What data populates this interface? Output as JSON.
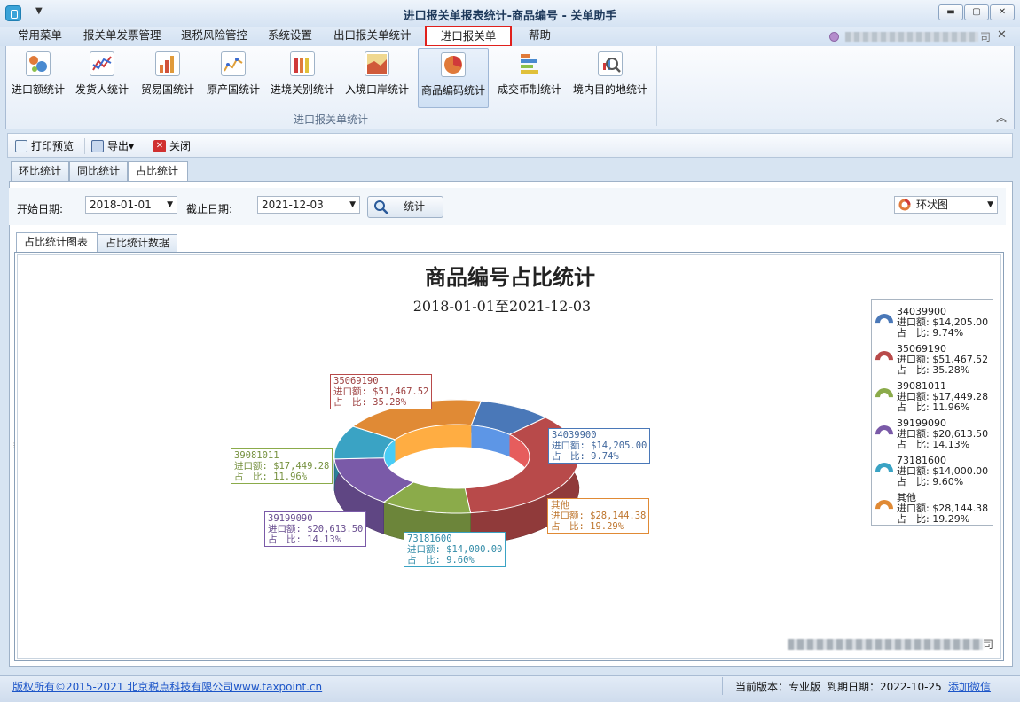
{
  "window": {
    "title": "进口报关单报表统计-商品编号 - 关单助手",
    "minimize_icon": "minimize-icon",
    "maximize_icon": "maximize-icon",
    "close_icon": "close-icon"
  },
  "menu": {
    "tabs": [
      "常用菜单",
      "报关单发票管理",
      "退税风险管控",
      "系统设置",
      "出口报关单统计",
      "进口报关单统计",
      "帮助"
    ],
    "active": "进口报关单统计",
    "user_suffix": "司",
    "close_glyph": "✕"
  },
  "ribbon": {
    "buttons": [
      "进口额统计",
      "发货人统计",
      "贸易国统计",
      "原产国统计",
      "进境关别统计",
      "入境口岸统计",
      "商品编码统计",
      "成交币制统计",
      "境内目的地统计"
    ],
    "active": "商品编码统计",
    "group_label": "进口报关单统计"
  },
  "toolbar": {
    "print_preview": "打印预览",
    "export": "导出",
    "export_arrow": "▾",
    "close": "关闭"
  },
  "tabs1": {
    "items": [
      "环比统计",
      "同比统计",
      "占比统计"
    ],
    "active": "占比统计"
  },
  "filter": {
    "start_label": "开始日期:",
    "start_value": "2018-01-01",
    "end_label": "截止日期:",
    "end_value": "2021-12-03",
    "stat_button": "统计",
    "chart_type": "环状图",
    "dropdown_arrow": "▼"
  },
  "tabs2": {
    "items": [
      "占比统计图表",
      "占比统计数据"
    ],
    "active": "占比统计图表"
  },
  "chart_data": {
    "type": "pie",
    "title": "商品编号占比统计",
    "subtitle": "2018-01-01至2021-12-03",
    "style": "3d-doughnut",
    "legend_position": "right",
    "value_label": "进口额",
    "share_label": "占　比",
    "slices": [
      {
        "name": "34039900",
        "value": "$14,205.00",
        "share": "9.74%",
        "amount": 14205.0,
        "percent": 9.74,
        "color": "#4a78b8"
      },
      {
        "name": "35069190",
        "value": "$51,467.52",
        "share": "35.28%",
        "amount": 51467.52,
        "percent": 35.28,
        "color": "#b84a4a"
      },
      {
        "name": "39081011",
        "value": "$17,449.28",
        "share": "11.96%",
        "amount": 17449.28,
        "percent": 11.96,
        "color": "#8bab4a"
      },
      {
        "name": "39199090",
        "value": "$20,613.50",
        "share": "14.13%",
        "amount": 20613.5,
        "percent": 14.13,
        "color": "#7a5aa8"
      },
      {
        "name": "73181600",
        "value": "$14,000.00",
        "share": "9.60%",
        "amount": 14000.0,
        "percent": 9.6,
        "color": "#3aa3c4"
      },
      {
        "name": "其他",
        "value": "$28,144.38",
        "share": "19.29%",
        "amount": 28144.38,
        "percent": 19.29,
        "color": "#e08a35"
      }
    ]
  },
  "watermark_suffix": "司",
  "status": {
    "copyright": "版权所有©2015-2021 北京税点科技有限公司www.taxpoint.cn",
    "version": "当前版本：专业版",
    "expire": "到期日期：2022-10-25",
    "wechat": "添加微信"
  }
}
